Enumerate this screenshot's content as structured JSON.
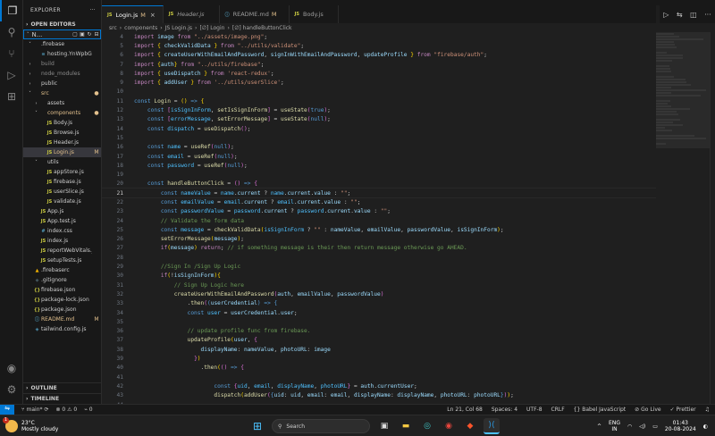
{
  "explorer": {
    "header": "EXPLORER",
    "more": "···",
    "open_editors": "OPEN EDITORS",
    "project": "N...",
    "tree": [
      {
        "indent": 0,
        "twisty": "˅",
        "icon": "",
        "icon_class": "",
        "name": ".firebase",
        "badge": "",
        "state": ""
      },
      {
        "indent": 1,
        "twisty": "",
        "icon": "≡",
        "icon_class": "info",
        "name": "hosting.YnWpbGQ.ca...",
        "badge": "",
        "state": ""
      },
      {
        "indent": 0,
        "twisty": "›",
        "icon": "",
        "icon_class": "",
        "name": "build",
        "badge": "",
        "state": "dim"
      },
      {
        "indent": 0,
        "twisty": "›",
        "icon": "",
        "icon_class": "",
        "name": "node_modules",
        "badge": "",
        "state": "dim"
      },
      {
        "indent": 0,
        "twisty": "›",
        "icon": "",
        "icon_class": "",
        "name": "public",
        "badge": "",
        "state": ""
      },
      {
        "indent": 0,
        "twisty": "˅",
        "icon": "",
        "icon_class": "",
        "name": "src",
        "badge": "●",
        "state": "mod"
      },
      {
        "indent": 1,
        "twisty": "›",
        "icon": "",
        "icon_class": "",
        "name": "assets",
        "badge": "",
        "state": ""
      },
      {
        "indent": 1,
        "twisty": "˅",
        "icon": "",
        "icon_class": "",
        "name": "components",
        "badge": "●",
        "state": "mod"
      },
      {
        "indent": 2,
        "twisty": "",
        "icon": "JS",
        "icon_class": "js",
        "name": "Body.js",
        "badge": "",
        "state": ""
      },
      {
        "indent": 2,
        "twisty": "",
        "icon": "JS",
        "icon_class": "js",
        "name": "Browse.js",
        "badge": "",
        "state": ""
      },
      {
        "indent": 2,
        "twisty": "",
        "icon": "JS",
        "icon_class": "js",
        "name": "Header.js",
        "badge": "",
        "state": ""
      },
      {
        "indent": 2,
        "twisty": "",
        "icon": "JS",
        "icon_class": "js",
        "name": "Login.js",
        "badge": "M",
        "state": "mod sel"
      },
      {
        "indent": 1,
        "twisty": "˅",
        "icon": "",
        "icon_class": "",
        "name": "utils",
        "badge": "",
        "state": ""
      },
      {
        "indent": 2,
        "twisty": "",
        "icon": "JS",
        "icon_class": "js",
        "name": "appStore.js",
        "badge": "",
        "state": ""
      },
      {
        "indent": 2,
        "twisty": "",
        "icon": "JS",
        "icon_class": "js",
        "name": "firebase.js",
        "badge": "",
        "state": ""
      },
      {
        "indent": 2,
        "twisty": "",
        "icon": "JS",
        "icon_class": "js",
        "name": "userSlice.js",
        "badge": "",
        "state": ""
      },
      {
        "indent": 2,
        "twisty": "",
        "icon": "JS",
        "icon_class": "js",
        "name": "validate.js",
        "badge": "",
        "state": ""
      },
      {
        "indent": 1,
        "twisty": "",
        "icon": "JS",
        "icon_class": "js",
        "name": "App.js",
        "badge": "",
        "state": ""
      },
      {
        "indent": 1,
        "twisty": "",
        "icon": "JS",
        "icon_class": "js",
        "name": "App.test.js",
        "badge": "",
        "state": ""
      },
      {
        "indent": 1,
        "twisty": "",
        "icon": "#",
        "icon_class": "css",
        "name": "index.css",
        "badge": "",
        "state": ""
      },
      {
        "indent": 1,
        "twisty": "",
        "icon": "JS",
        "icon_class": "js",
        "name": "index.js",
        "badge": "",
        "state": ""
      },
      {
        "indent": 1,
        "twisty": "",
        "icon": "JS",
        "icon_class": "js",
        "name": "reportWebVitals.js",
        "badge": "",
        "state": ""
      },
      {
        "indent": 1,
        "twisty": "",
        "icon": "JS",
        "icon_class": "js",
        "name": "setupTests.js",
        "badge": "",
        "state": ""
      },
      {
        "indent": 0,
        "twisty": "",
        "icon": "▲",
        "icon_class": "fb",
        "name": ".firebaserc",
        "badge": "",
        "state": ""
      },
      {
        "indent": 0,
        "twisty": "",
        "icon": "◆",
        "icon_class": "git",
        "name": ".gitignore",
        "badge": "",
        "state": ""
      },
      {
        "indent": 0,
        "twisty": "",
        "icon": "{}",
        "icon_class": "json",
        "name": "firebase.json",
        "badge": "",
        "state": ""
      },
      {
        "indent": 0,
        "twisty": "",
        "icon": "{}",
        "icon_class": "json",
        "name": "package-lock.json",
        "badge": "",
        "state": ""
      },
      {
        "indent": 0,
        "twisty": "",
        "icon": "{}",
        "icon_class": "json",
        "name": "package.json",
        "badge": "",
        "state": ""
      },
      {
        "indent": 0,
        "twisty": "",
        "icon": "ⓘ",
        "icon_class": "info",
        "name": "README.md",
        "badge": "M",
        "state": "mod"
      },
      {
        "indent": 0,
        "twisty": "",
        "icon": "◈",
        "icon_class": "info",
        "name": "tailwind.config.js",
        "badge": "",
        "state": ""
      }
    ],
    "outline": "OUTLINE",
    "timeline": "TIMELINE"
  },
  "tabs": [
    {
      "icon": "JS",
      "icon_class": "js",
      "label": "Login.js",
      "modified": "M",
      "close": "×",
      "active": true,
      "italic": false
    },
    {
      "icon": "JS",
      "icon_class": "js",
      "label": "Header.js",
      "modified": "",
      "close": "",
      "active": false,
      "italic": true
    },
    {
      "icon": "ⓘ",
      "icon_class": "md",
      "label": "README.md",
      "modified": "M",
      "close": "",
      "active": false,
      "italic": false
    },
    {
      "icon": "JS",
      "icon_class": "js",
      "label": "Body.js",
      "modified": "",
      "close": "",
      "active": false,
      "italic": false
    }
  ],
  "breadcrumb": [
    "src",
    "components",
    "JS Login.js",
    "[∅] Login",
    "[∅] handleButtonClick"
  ],
  "code": [
    {
      "n": "4",
      "h": "<span class='k'>import</span> <span class='v'>image</span> <span class='k'>from</span> <span class='s'>\"../assets/image.png\"</span>;"
    },
    {
      "n": "5",
      "h": "<span class='k'>import</span> <span class='y'>{</span> <span class='v'>checkValidData</span> <span class='y'>}</span> <span class='k'>from</span> <span class='s'>\"../utils/validate\"</span>;"
    },
    {
      "n": "6",
      "h": "<span class='k'>import</span> <span class='y'>{</span> <span class='v'>createUserWithEmailAndPassword</span>, <span class='v'>signInWithEmailAndPassword</span>, <span class='v'>updateProfile</span> <span class='y'>}</span> <span class='k'>from</span> <span class='s'>\"firebase/auth\"</span>;"
    },
    {
      "n": "7",
      "h": "<span class='k'>import</span> <span class='y'>{</span><span class='v'>auth</span><span class='y'>}</span> <span class='k'>from</span> <span class='s'>\"../utils/firebase\"</span>;"
    },
    {
      "n": "8",
      "h": "<span class='k'>import</span> <span class='y'>{</span> <span class='v'>useDispatch</span> <span class='y'>}</span> <span class='k'>from</span> <span class='s'>'react-redux'</span>;"
    },
    {
      "n": "9",
      "h": "<span class='k'>import</span> <span class='y'>{</span> <span class='v'>addUser</span> <span class='y'>}</span> <span class='k'>from</span> <span class='s'>'../utils/userSlice'</span>;"
    },
    {
      "n": "10",
      "h": ""
    },
    {
      "n": "11",
      "h": "<span class='d'>const</span> <span class='f'>Login</span> = <span class='y'>()</span> <span class='d'>=&gt;</span> <span class='y'>{</span>"
    },
    {
      "n": "12",
      "h": "    <span class='d'>const</span> <span class='p'>[</span><span class='c'>isSignInForm</span>, <span class='f'>setIsSignInForm</span><span class='p'>]</span> = <span class='f'>useState</span><span class='p'>(</span><span class='d'>true</span><span class='p'>)</span>;"
    },
    {
      "n": "13",
      "h": "    <span class='d'>const</span> <span class='p'>[</span><span class='c'>errorMessage</span>, <span class='f'>setErrorMessage</span><span class='p'>]</span> = <span class='f'>useState</span><span class='p'>(</span><span class='d'>null</span><span class='p'>)</span>;"
    },
    {
      "n": "14",
      "h": "    <span class='d'>const</span> <span class='c'>dispatch</span> = <span class='f'>useDispatch</span><span class='p'>()</span>;"
    },
    {
      "n": "15",
      "h": ""
    },
    {
      "n": "16",
      "h": "    <span class='d'>const</span> <span class='c'>name</span> = <span class='f'>useRef</span><span class='p'>(</span><span class='d'>null</span><span class='p'>)</span>;"
    },
    {
      "n": "17",
      "h": "    <span class='d'>const</span> <span class='c'>email</span> = <span class='f'>useRef</span><span class='p'>(</span><span class='d'>null</span><span class='p'>)</span>;"
    },
    {
      "n": "18",
      "h": "    <span class='d'>const</span> <span class='c'>password</span> = <span class='f'>useRef</span><span class='p'>(</span><span class='d'>null</span><span class='p'>)</span>;"
    },
    {
      "n": "19",
      "h": ""
    },
    {
      "n": "20",
      "h": "    <span class='d'>const</span> <span class='f'>handleButtonClick</span> = <span class='p'>()</span> <span class='d'>=&gt;</span> <span class='p'>{</span>"
    },
    {
      "n": "21",
      "h": "        <span class='d'>const</span> <span class='c'>nameValue</span> = <span class='c'>name</span>.<span class='v'>current</span> ? <span class='c'>name</span>.<span class='v'>current</span>.<span class='v'>value</span> : <span class='s'>\"\"</span>;",
      "cur": true
    },
    {
      "n": "22",
      "h": "        <span class='d'>const</span> <span class='c'>emailValue</span> = <span class='c'>email</span>.<span class='v'>current</span> ? <span class='c'>email</span>.<span class='v'>current</span>.<span class='v'>value</span> : <span class='s'>\"\"</span>;"
    },
    {
      "n": "23",
      "h": "        <span class='d'>const</span> <span class='c'>passwordValue</span> = <span class='c'>password</span>.<span class='v'>current</span> ? <span class='c'>password</span>.<span class='v'>current</span>.<span class='v'>value</span> : <span class='s'>\"\"</span>;"
    },
    {
      "n": "24",
      "h": "        <span class='cm'>// Validate the form data</span>"
    },
    {
      "n": "25",
      "h": "        <span class='d'>const</span> <span class='c'>message</span> = <span class='f'>checkValidData</span><span class='y'>(</span><span class='c'>isSignInForm</span> ? <span class='s'>\"\"</span> : <span class='v'>nameValue</span>, <span class='v'>emailValue</span>, <span class='v'>passwordValue</span>, <span class='v'>isSignInForm</span><span class='y'>)</span>;"
    },
    {
      "n": "26",
      "h": "        <span class='f'>setErrorMessage</span><span class='y'>(</span><span class='v'>message</span><span class='y'>)</span>;"
    },
    {
      "n": "27",
      "h": "        <span class='k'>if</span><span class='y'>(</span><span class='v'>message</span><span class='y'>)</span> <span class='k'>return</span>; <span class='cm'>// if something message is their then return message otherwise go AHEAD.</span>"
    },
    {
      "n": "28",
      "h": ""
    },
    {
      "n": "29",
      "h": "        <span class='cm'>//Sign In /Sign Up Logic</span>"
    },
    {
      "n": "30",
      "h": "        <span class='k'>if</span><span class='y'>(</span>!<span class='v'>isSignInForm</span><span class='y'>){</span>"
    },
    {
      "n": "31",
      "h": "            <span class='cm'>// Sign Up Logic here</span>"
    },
    {
      "n": "32",
      "h": "            <span class='f'>createUserWithEmailAndPassword</span><span class='p'>(</span><span class='v'>auth</span>, <span class='v'>emailValue</span>, <span class='v'>passwordValue</span><span class='p'>)</span>"
    },
    {
      "n": "33",
      "h": "                .<span class='f'>then</span><span class='p'>(</span><span class='d'>(</span><span class='v'>userCredential</span><span class='d'>)</span> <span class='d'>=&gt;</span> <span class='d'>{</span>"
    },
    {
      "n": "34",
      "h": "                <span class='d'>const</span> <span class='c'>user</span> = <span class='v'>userCredential</span>.<span class='v'>user</span>;"
    },
    {
      "n": "35",
      "h": ""
    },
    {
      "n": "36",
      "h": "                <span class='cm'>// update profile func from firebase.</span>"
    },
    {
      "n": "37",
      "h": "                <span class='f'>updateProfile</span><span class='y'>(</span><span class='v'>user</span>, <span class='p'>{</span>"
    },
    {
      "n": "38",
      "h": "                    <span class='v'>displayName</span>: <span class='v'>nameValue</span>, <span class='v'>photoURL</span>: <span class='v'>image</span>"
    },
    {
      "n": "39",
      "h": "                  <span class='p'>}</span><span class='y'>)</span>"
    },
    {
      "n": "40",
      "h": "                    .<span class='f'>then</span><span class='y'>(</span><span class='p'>()</span> <span class='d'>=&gt;</span> <span class='p'>{</span>"
    },
    {
      "n": "41",
      "h": ""
    },
    {
      "n": "42",
      "h": "                        <span class='d'>const</span> <span class='p'>{</span><span class='c'>uid</span>, <span class='c'>email</span>, <span class='c'>displayName</span>, <span class='c'>photoURL</span><span class='p'>}</span> = <span class='v'>auth</span>.<span class='v'>currentUser</span>;"
    },
    {
      "n": "43",
      "h": "                        <span class='f'>dispatch</span><span class='y'>(</span><span class='f'>addUser</span><span class='p'>(</span><span class='d'>{</span><span class='v'>uid</span>: <span class='v'>uid</span>, <span class='v'>email</span>: <span class='v'>email</span>, <span class='v'>displayName</span>: <span class='v'>displayName</span>, <span class='v'>photoURL</span>: <span class='v'>photoURL</span><span class='d'>}</span><span class='p'>)</span><span class='y'>)</span>;"
    },
    {
      "n": "44",
      "h": ""
    },
    {
      "n": "45",
      "h": "                    <span class='p'>})</span>"
    }
  ],
  "status": {
    "branch": "main*",
    "sync": "⟳",
    "problems": "⊗ 0 ⚠ 0",
    "ports": "⌁ 0",
    "position": "Ln 21, Col 68",
    "spaces": "Spaces: 4",
    "encoding": "UTF-8",
    "eol": "CRLF",
    "language": "{} Babel JavaScript",
    "golive": "⊘ Go Live",
    "prettier": "✓ Prettier",
    "bell": "🔔"
  },
  "taskbar": {
    "weather_temp": "23°C",
    "weather_desc": "Mostly cloudy",
    "notif_count": "1",
    "search_placeholder": "Search",
    "lang": "ENG",
    "region": "IN",
    "time": "01:43",
    "date": "20-08-2024",
    "caret": "^"
  }
}
